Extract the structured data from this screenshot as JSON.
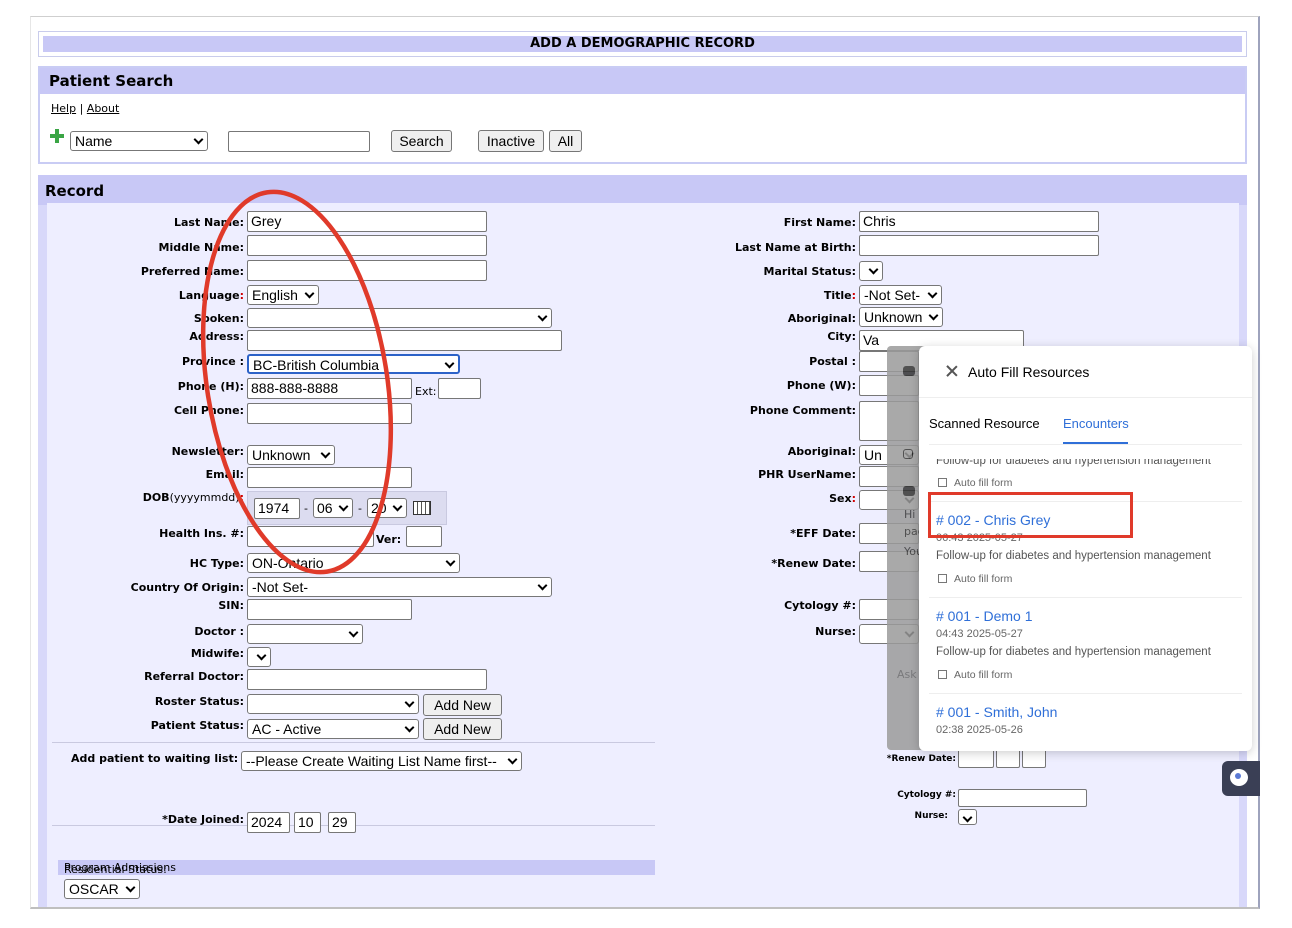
{
  "page": {
    "title": "ADD A DEMOGRAPHIC RECORD"
  },
  "patient_search": {
    "heading": "Patient Search",
    "help_link": "Help",
    "separator": "|",
    "about_link": "About",
    "search_type": "Name",
    "search_value": "",
    "search_button": "Search",
    "inactive_button": "Inactive",
    "all_button": "All"
  },
  "record": {
    "heading": "Record",
    "left": {
      "last_name_label": "Last Name:",
      "last_name": "Grey",
      "middle_name_label": "Middle Name:",
      "preferred_name_label": "Preferred Name:",
      "language_label": "Language",
      "language_colon": ":",
      "language": "English",
      "spoken_label": "Spoken:",
      "address_label": "Address:",
      "province_label": "Province :",
      "province": "BC-British Columbia",
      "phone_h_label": "Phone (H):",
      "phone_h": "888-888-8888",
      "ext_label": "Ext:",
      "cell_phone_label": "Cell Phone:",
      "newsletter_label": "Newsletter:",
      "newsletter": "Unknown",
      "email_label": "Email:",
      "dob_label": "DOB",
      "dob_format": "(yyyymmdd)",
      "dob_colon": ":",
      "dob_year": "1974",
      "dob_month": "06",
      "dob_day": "20",
      "dob_sep": "-",
      "health_ins_label": "Health Ins. #:",
      "ver_label": "Ver:",
      "hc_type_label": "HC Type:",
      "hc_type": "ON-Ontario",
      "country_label": "Country Of Origin:",
      "country": "-Not Set-",
      "sin_label": "SIN:",
      "doctor_label": "Doctor :",
      "midwife_label": "Midwife:",
      "referral_doctor_label": "Referral Doctor:",
      "roster_status_label": "Roster Status:",
      "add_new_1": "Add New",
      "patient_status_label": "Patient Status:",
      "patient_status": "AC - Active",
      "add_new_2": "Add New",
      "waiting_list_label": "Add patient to waiting list:",
      "waiting_list": "--Please Create Waiting List Name first--",
      "date_joined_label": "*Date Joined:",
      "date_joined_year": "2024",
      "date_joined_month": "10",
      "date_joined_day": "29",
      "program_admissions": "Program Admissions",
      "residential_status_label": "Residential Status:",
      "residential_status": "OSCAR"
    },
    "right": {
      "first_name_label": "First Name:",
      "first_name": "Chris",
      "last_name_birth_label": "Last Name at Birth:",
      "marital_status_label": "Marital Status:",
      "title_label": "Title",
      "title_colon": ":",
      "title": "-Not Set-",
      "aboriginal_label": "Aboriginal:",
      "aboriginal": "Unknown",
      "city_label": "City:",
      "city": "Va",
      "postal_label": "Postal :",
      "phone_w_label": "Phone (W):",
      "phone_comment_label": "Phone Comment:",
      "aboriginal2_label": "Aboriginal:",
      "aboriginal2": "Un",
      "phr_label": "PHR UserName:",
      "sex_label": "Sex",
      "sex_colon": ":",
      "eff_date_label": "*EFF Date:",
      "renew_date_label": "*Renew Date:",
      "cytology_label": "Cytology #:",
      "nurse_label": "Nurse:"
    },
    "behind": {
      "renew_date_label": "*Renew Date:",
      "cytology_label": "Cytology #:",
      "nurse_label": "Nurse:"
    }
  },
  "chat_overlay": {
    "greeting": "Hi",
    "line2": "pag",
    "line3": "You",
    "ask": "Ask"
  },
  "auto_fill_panel": {
    "title": "Auto Fill Resources",
    "tabs": [
      "Scanned Resource",
      "Encounters"
    ],
    "active_tab": "Encounters",
    "partial_item": {
      "description": "Follow-up for diabetes and hypertension management",
      "action": "Auto fill form"
    },
    "encounters": [
      {
        "title": "# 002 - Chris Grey",
        "time": "06:43 2025-05-27",
        "description": "Follow-up for diabetes and hypertension management",
        "action": "Auto fill form"
      },
      {
        "title": "# 001 - Demo 1",
        "time": "04:43 2025-05-27",
        "description": "Follow-up for diabetes and hypertension management",
        "action": "Auto fill form"
      },
      {
        "title": "# 001 - Smith, John",
        "time": "02:38 2025-05-26"
      }
    ]
  },
  "colors": {
    "header_band": "#c8c8f6",
    "record_body": "#eeeeff",
    "accent_blue": "#2f6fd8",
    "annotation_red": "#e03a2a"
  }
}
